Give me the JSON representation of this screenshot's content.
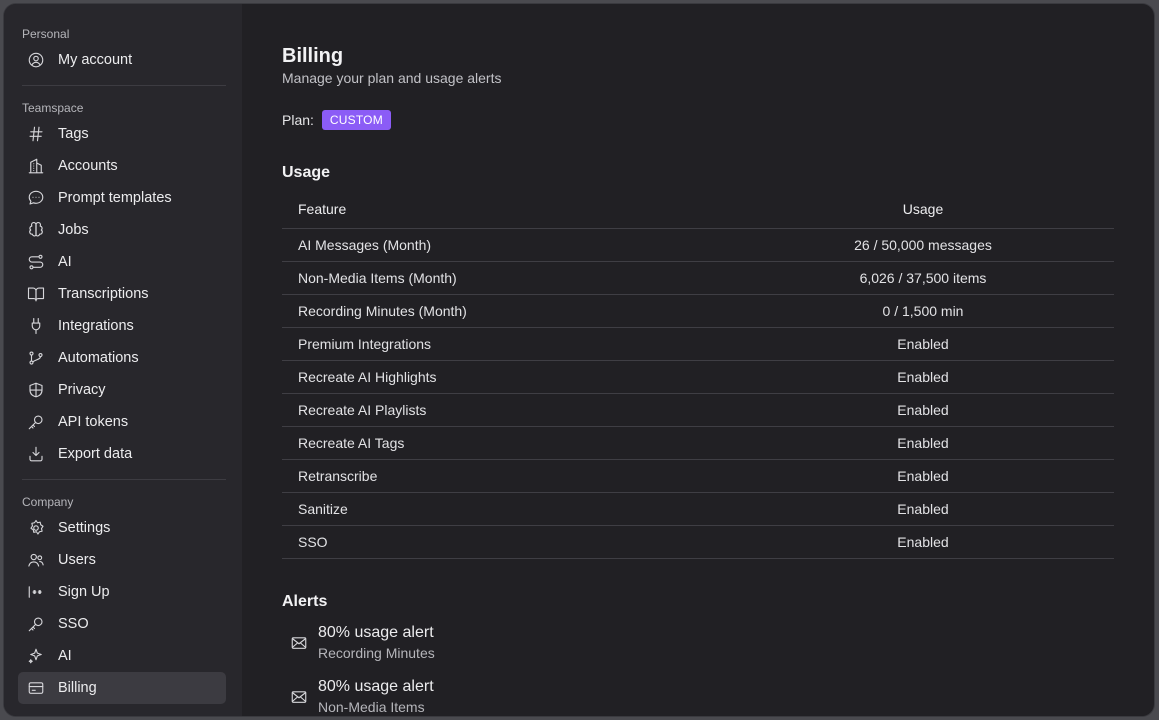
{
  "sidebar": {
    "personal_label": "Personal",
    "personal_items": [
      {
        "label": "My account",
        "icon": "user-circle-icon"
      }
    ],
    "teamspace_label": "Teamspace",
    "teamspace_items": [
      {
        "label": "Tags",
        "icon": "hash-icon"
      },
      {
        "label": "Accounts",
        "icon": "building-icon"
      },
      {
        "label": "Prompt templates",
        "icon": "chat-bubble-icon"
      },
      {
        "label": "Jobs",
        "icon": "brain-icon"
      },
      {
        "label": "AI",
        "icon": "route-icon"
      },
      {
        "label": "Transcriptions",
        "icon": "book-open-icon"
      },
      {
        "label": "Integrations",
        "icon": "plug-icon"
      },
      {
        "label": "Automations",
        "icon": "git-branch-icon"
      },
      {
        "label": "Privacy",
        "icon": "shield-icon"
      },
      {
        "label": "API tokens",
        "icon": "key-icon"
      },
      {
        "label": "Export data",
        "icon": "download-tray-icon"
      }
    ],
    "company_label": "Company",
    "company_items": [
      {
        "label": "Settings",
        "icon": "gear-icon"
      },
      {
        "label": "Users",
        "icon": "users-icon"
      },
      {
        "label": "Sign Up",
        "icon": "password-icon"
      },
      {
        "label": "SSO",
        "icon": "key-icon"
      },
      {
        "label": "AI",
        "icon": "sparkle-icon"
      },
      {
        "label": "Billing",
        "icon": "credit-card-icon",
        "active": true
      }
    ]
  },
  "main": {
    "title": "Billing",
    "subtitle": "Manage your plan and usage alerts",
    "plan_label": "Plan:",
    "plan_badge": "CUSTOM",
    "usage_title": "Usage",
    "table": {
      "headers": [
        "Feature",
        "Usage"
      ],
      "rows": [
        [
          "AI Messages (Month)",
          "26 / 50,000 messages"
        ],
        [
          "Non-Media Items (Month)",
          "6,026 / 37,500 items"
        ],
        [
          "Recording Minutes (Month)",
          "0 / 1,500 min"
        ],
        [
          "Premium Integrations",
          "Enabled"
        ],
        [
          "Recreate AI Highlights",
          "Enabled"
        ],
        [
          "Recreate AI Playlists",
          "Enabled"
        ],
        [
          "Recreate AI Tags",
          "Enabled"
        ],
        [
          "Retranscribe",
          "Enabled"
        ],
        [
          "Sanitize",
          "Enabled"
        ],
        [
          "SSO",
          "Enabled"
        ]
      ]
    },
    "alerts_title": "Alerts",
    "alerts": [
      {
        "title": "80% usage alert",
        "subtitle": "Recording Minutes",
        "icon": "mail-icon"
      },
      {
        "title": "80% usage alert",
        "subtitle": "Non-Media Items",
        "icon": "mail-icon"
      }
    ]
  },
  "colors": {
    "accent": "#8b5cf6",
    "background": "#212024",
    "sidebar": "#28272c"
  }
}
